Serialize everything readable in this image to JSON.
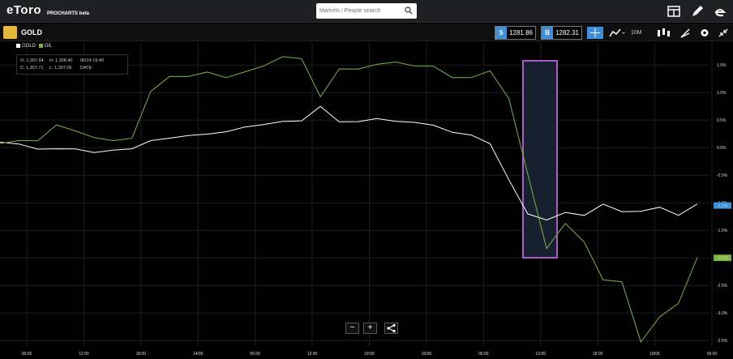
{
  "header": {
    "logo": "eToro",
    "product": "PROCHARTS beta",
    "search_placeholder": "Markets / People search",
    "icons": [
      "layout-icon",
      "edit-icon",
      "etoro-icon"
    ]
  },
  "toolbar": {
    "asset": "GOLD",
    "sell_label": "S",
    "sell_price": "1281.86",
    "buy_label": "B",
    "buy_price": "1282.31",
    "interval": "10M"
  },
  "legend": {
    "gold_label": "GOLD",
    "oil_label": "OIL"
  },
  "ohlc": {
    "open": "O: 1,307.64",
    "high": "H: 1,308.40",
    "datetime": "06/14 15:40",
    "close": "C: 1,307.71",
    "low": "L: 1,307.06",
    "date_label": "DATE"
  },
  "colors": {
    "gold": "#ffffff",
    "oil": "#7cb342",
    "accent": "#3d8fd9",
    "highlight": "#b05ac9"
  },
  "chart_data": {
    "type": "line",
    "x_tick_labels": [
      "00:00",
      "12:00",
      "18:00",
      "14/06",
      "06:00",
      "12:00",
      "18:00",
      "15/06",
      "06:00",
      "12:00",
      "18:00",
      "18/06",
      "00:00"
    ],
    "y_tick_labels": [
      "1.5%",
      "1.0%",
      "0.5%",
      "0.0%",
      "-0.5%",
      "-1.0%",
      "-1.5%",
      "-2.0%",
      "-2.5%",
      "-3.0%",
      "-3.5%"
    ],
    "y_ticks": [
      1.5,
      1.0,
      0.5,
      0.0,
      -0.5,
      -1.0,
      -1.5,
      -2.0,
      -2.5,
      -3.0,
      -3.5
    ],
    "ylim": [
      -3.6,
      1.9
    ],
    "series": [
      {
        "name": "GOLD",
        "color": "#ffffff",
        "values": [
          0.1,
          0.05,
          0.0,
          -0.05,
          0.0,
          -0.1,
          -0.05,
          0.0,
          0.1,
          0.2,
          0.2,
          0.25,
          0.3,
          0.35,
          0.45,
          0.45,
          0.5,
          0.75,
          0.45,
          0.5,
          0.5,
          0.5,
          0.45,
          0.4,
          0.3,
          0.2,
          0.1,
          -0.6,
          -1.2,
          -1.3,
          -1.2,
          -1.2,
          -1.05,
          -1.15,
          -1.15,
          -1.1,
          -1.2,
          -1.05
        ]
      },
      {
        "name": "OIL",
        "color": "#7cb342",
        "values": [
          0.1,
          0.1,
          0.15,
          0.4,
          0.3,
          0.2,
          0.1,
          0.2,
          1.0,
          1.3,
          1.3,
          1.35,
          1.3,
          1.35,
          1.5,
          1.65,
          1.6,
          0.95,
          1.4,
          1.45,
          1.5,
          1.55,
          1.5,
          1.45,
          1.3,
          1.25,
          1.4,
          0.9,
          -0.5,
          -1.8,
          -1.4,
          -1.7,
          -2.4,
          -2.45,
          -3.5,
          -3.1,
          -2.8,
          -2.0
        ]
      }
    ],
    "last_labels": [
      "-1.1%",
      "-2.1%"
    ]
  }
}
